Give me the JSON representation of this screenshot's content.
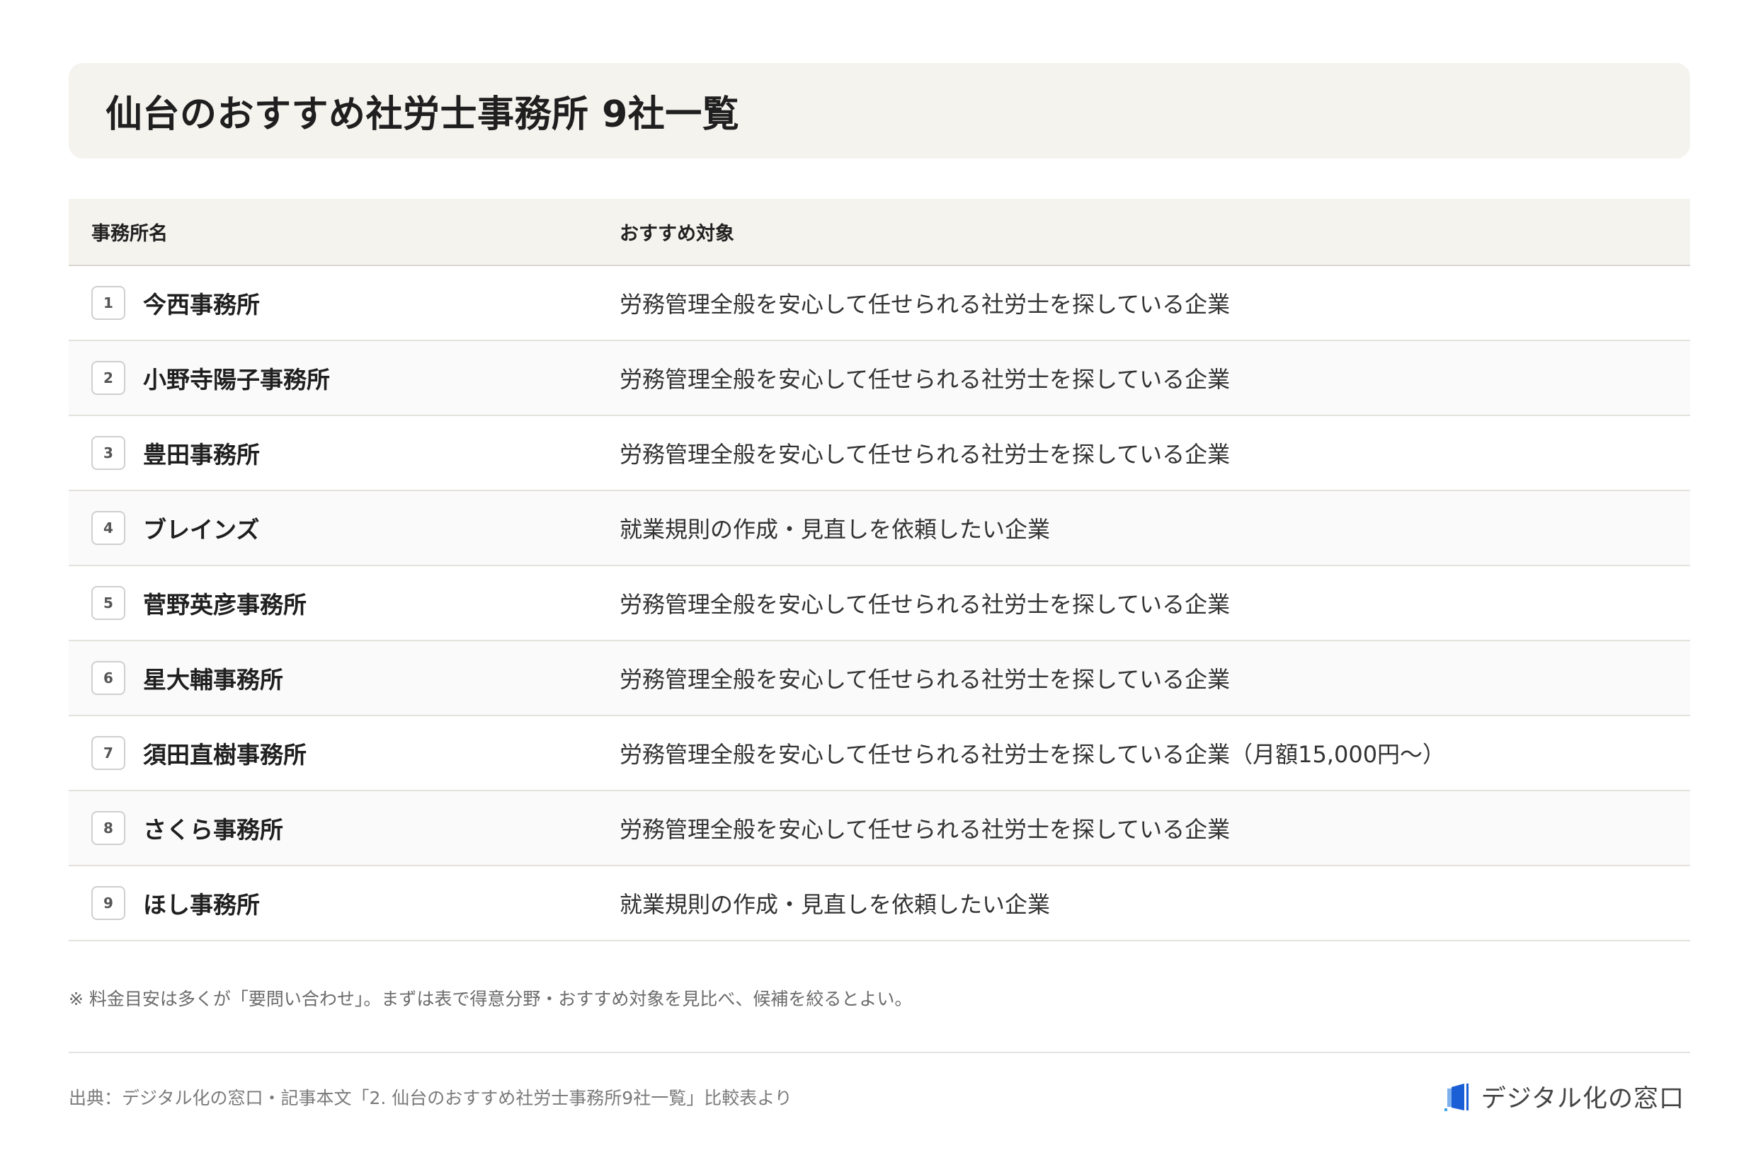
{
  "title": "仙台のおすすめ社労士事務所 9社一覧",
  "table": {
    "headers": {
      "name": "事務所名",
      "target": "おすすめ対象"
    },
    "rows": [
      {
        "no": "1",
        "name": "今西事務所",
        "target": "労務管理全般を安心して任せられる社労士を探している企業"
      },
      {
        "no": "2",
        "name": "小野寺陽子事務所",
        "target": "労務管理全般を安心して任せられる社労士を探している企業"
      },
      {
        "no": "3",
        "name": "豊田事務所",
        "target": "労務管理全般を安心して任せられる社労士を探している企業"
      },
      {
        "no": "4",
        "name": "ブレインズ",
        "target": "就業規則の作成・見直しを依頼したい企業"
      },
      {
        "no": "5",
        "name": "菅野英彦事務所",
        "target": "労務管理全般を安心して任せられる社労士を探している企業"
      },
      {
        "no": "6",
        "name": "星大輔事務所",
        "target": "労務管理全般を安心して任せられる社労士を探している企業"
      },
      {
        "no": "7",
        "name": "須田直樹事務所",
        "target": "労務管理全般を安心して任せられる社労士を探している企業（月額15,000円〜）"
      },
      {
        "no": "8",
        "name": "さくら事務所",
        "target": "労務管理全般を安心して任せられる社労士を探している企業"
      },
      {
        "no": "9",
        "name": "ほし事務所",
        "target": "就業規則の作成・見直しを依頼したい企業"
      }
    ]
  },
  "note": "※ 料金目安は多くが「要問い合わせ」。まずは表で得意分野・おすすめ対象を見比べ、候補を絞るとよい。",
  "footer": {
    "source": "出典：デジタル化の窓口・記事本文「2. 仙台のおすすめ社労士事務所9社一覧」比較表より",
    "brand_name": "デジタル化の窓口",
    "brand_icon": "window-logo-icon",
    "brand_color": "#1a5fd6"
  }
}
